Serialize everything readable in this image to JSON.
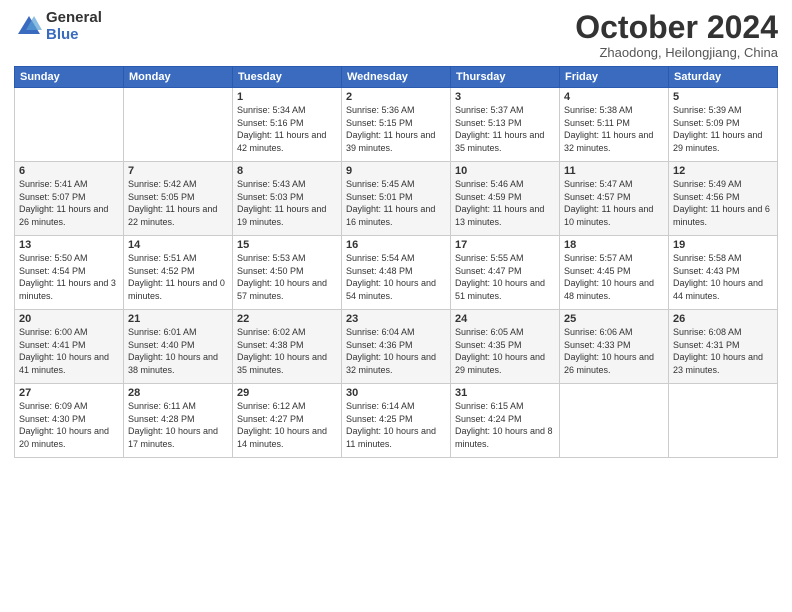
{
  "logo": {
    "general": "General",
    "blue": "Blue"
  },
  "header": {
    "month": "October 2024",
    "location": "Zhaodong, Heilongjiang, China"
  },
  "days_of_week": [
    "Sunday",
    "Monday",
    "Tuesday",
    "Wednesday",
    "Thursday",
    "Friday",
    "Saturday"
  ],
  "weeks": [
    [
      {
        "day": "",
        "info": ""
      },
      {
        "day": "",
        "info": ""
      },
      {
        "day": "1",
        "info": "Sunrise: 5:34 AM\nSunset: 5:16 PM\nDaylight: 11 hours and 42 minutes."
      },
      {
        "day": "2",
        "info": "Sunrise: 5:36 AM\nSunset: 5:15 PM\nDaylight: 11 hours and 39 minutes."
      },
      {
        "day": "3",
        "info": "Sunrise: 5:37 AM\nSunset: 5:13 PM\nDaylight: 11 hours and 35 minutes."
      },
      {
        "day": "4",
        "info": "Sunrise: 5:38 AM\nSunset: 5:11 PM\nDaylight: 11 hours and 32 minutes."
      },
      {
        "day": "5",
        "info": "Sunrise: 5:39 AM\nSunset: 5:09 PM\nDaylight: 11 hours and 29 minutes."
      }
    ],
    [
      {
        "day": "6",
        "info": "Sunrise: 5:41 AM\nSunset: 5:07 PM\nDaylight: 11 hours and 26 minutes."
      },
      {
        "day": "7",
        "info": "Sunrise: 5:42 AM\nSunset: 5:05 PM\nDaylight: 11 hours and 22 minutes."
      },
      {
        "day": "8",
        "info": "Sunrise: 5:43 AM\nSunset: 5:03 PM\nDaylight: 11 hours and 19 minutes."
      },
      {
        "day": "9",
        "info": "Sunrise: 5:45 AM\nSunset: 5:01 PM\nDaylight: 11 hours and 16 minutes."
      },
      {
        "day": "10",
        "info": "Sunrise: 5:46 AM\nSunset: 4:59 PM\nDaylight: 11 hours and 13 minutes."
      },
      {
        "day": "11",
        "info": "Sunrise: 5:47 AM\nSunset: 4:57 PM\nDaylight: 11 hours and 10 minutes."
      },
      {
        "day": "12",
        "info": "Sunrise: 5:49 AM\nSunset: 4:56 PM\nDaylight: 11 hours and 6 minutes."
      }
    ],
    [
      {
        "day": "13",
        "info": "Sunrise: 5:50 AM\nSunset: 4:54 PM\nDaylight: 11 hours and 3 minutes."
      },
      {
        "day": "14",
        "info": "Sunrise: 5:51 AM\nSunset: 4:52 PM\nDaylight: 11 hours and 0 minutes."
      },
      {
        "day": "15",
        "info": "Sunrise: 5:53 AM\nSunset: 4:50 PM\nDaylight: 10 hours and 57 minutes."
      },
      {
        "day": "16",
        "info": "Sunrise: 5:54 AM\nSunset: 4:48 PM\nDaylight: 10 hours and 54 minutes."
      },
      {
        "day": "17",
        "info": "Sunrise: 5:55 AM\nSunset: 4:47 PM\nDaylight: 10 hours and 51 minutes."
      },
      {
        "day": "18",
        "info": "Sunrise: 5:57 AM\nSunset: 4:45 PM\nDaylight: 10 hours and 48 minutes."
      },
      {
        "day": "19",
        "info": "Sunrise: 5:58 AM\nSunset: 4:43 PM\nDaylight: 10 hours and 44 minutes."
      }
    ],
    [
      {
        "day": "20",
        "info": "Sunrise: 6:00 AM\nSunset: 4:41 PM\nDaylight: 10 hours and 41 minutes."
      },
      {
        "day": "21",
        "info": "Sunrise: 6:01 AM\nSunset: 4:40 PM\nDaylight: 10 hours and 38 minutes."
      },
      {
        "day": "22",
        "info": "Sunrise: 6:02 AM\nSunset: 4:38 PM\nDaylight: 10 hours and 35 minutes."
      },
      {
        "day": "23",
        "info": "Sunrise: 6:04 AM\nSunset: 4:36 PM\nDaylight: 10 hours and 32 minutes."
      },
      {
        "day": "24",
        "info": "Sunrise: 6:05 AM\nSunset: 4:35 PM\nDaylight: 10 hours and 29 minutes."
      },
      {
        "day": "25",
        "info": "Sunrise: 6:06 AM\nSunset: 4:33 PM\nDaylight: 10 hours and 26 minutes."
      },
      {
        "day": "26",
        "info": "Sunrise: 6:08 AM\nSunset: 4:31 PM\nDaylight: 10 hours and 23 minutes."
      }
    ],
    [
      {
        "day": "27",
        "info": "Sunrise: 6:09 AM\nSunset: 4:30 PM\nDaylight: 10 hours and 20 minutes."
      },
      {
        "day": "28",
        "info": "Sunrise: 6:11 AM\nSunset: 4:28 PM\nDaylight: 10 hours and 17 minutes."
      },
      {
        "day": "29",
        "info": "Sunrise: 6:12 AM\nSunset: 4:27 PM\nDaylight: 10 hours and 14 minutes."
      },
      {
        "day": "30",
        "info": "Sunrise: 6:14 AM\nSunset: 4:25 PM\nDaylight: 10 hours and 11 minutes."
      },
      {
        "day": "31",
        "info": "Sunrise: 6:15 AM\nSunset: 4:24 PM\nDaylight: 10 hours and 8 minutes."
      },
      {
        "day": "",
        "info": ""
      },
      {
        "day": "",
        "info": ""
      }
    ]
  ]
}
